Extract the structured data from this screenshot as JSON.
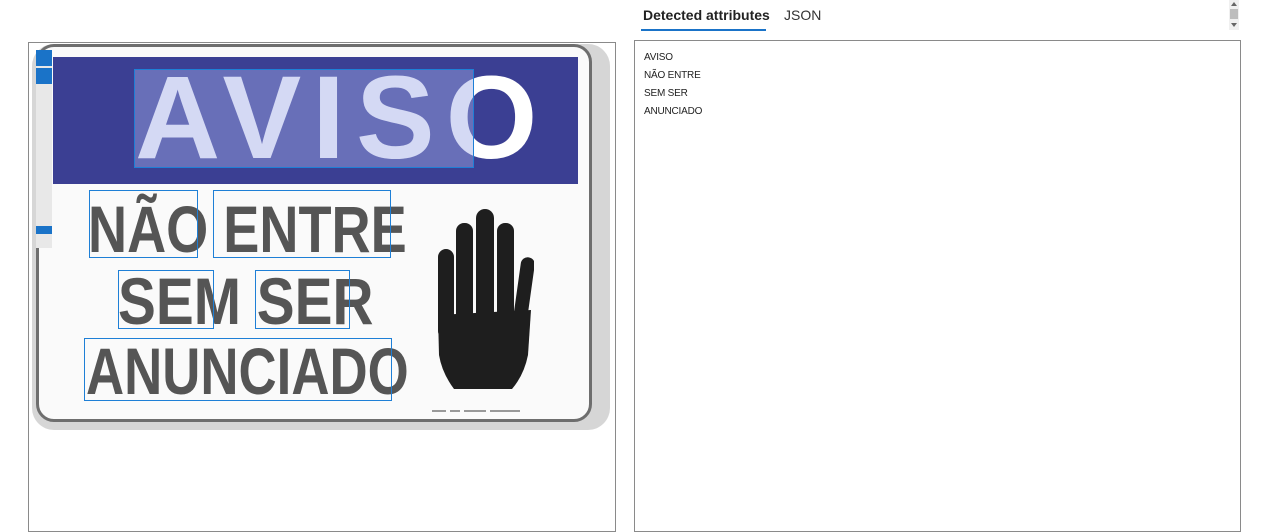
{
  "tabs": [
    {
      "label": "Detected attributes",
      "active": true
    },
    {
      "label": "JSON",
      "active": false
    }
  ],
  "image": {
    "sign_title": "AVISO",
    "sign_line1": "NÃO ENTRE",
    "sign_line2": "SEM SER",
    "sign_line3": "ANUNCIADO",
    "hand_icon": "raised-hand-icon",
    "band_color": "#3b3f93",
    "box_color": "#1e7fd6"
  },
  "results": {
    "lines": [
      "AVISO",
      "NÃO ENTRE",
      "SEM SER",
      "ANUNCIADO"
    ]
  }
}
